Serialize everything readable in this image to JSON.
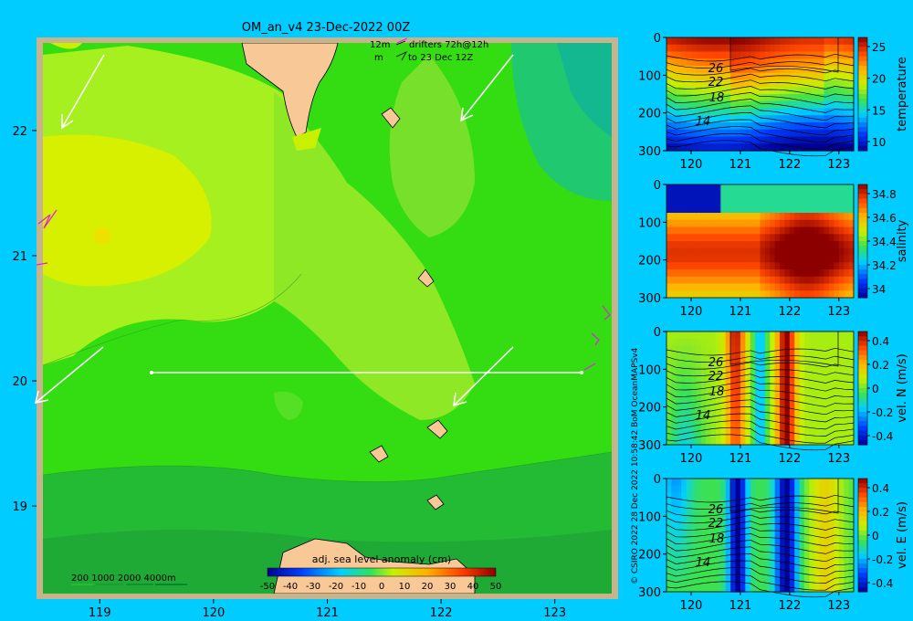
{
  "header": {
    "title": "OM_an_v4  23-Dec-2022 00Z",
    "legend_line1_left": "12m",
    "legend_line1_right": "drifters 72h@12h",
    "legend_line2_left": "m",
    "legend_line2_right": "to 23 Dec 12Z"
  },
  "map": {
    "x_ticks": [
      "119",
      "120",
      "121",
      "122",
      "123"
    ],
    "y_ticks": [
      "22",
      "21",
      "20",
      "19"
    ],
    "bathymetry_legend": "200  1000  2000  4000m",
    "colorbar_title": "adj. sea level anomaly (cm)",
    "colorbar_ticks": [
      "-50",
      "-40",
      "-30",
      "-20",
      "-10",
      "0",
      "10",
      "20",
      "30",
      "40",
      "50"
    ],
    "section_lat": 20,
    "section_lon_range": [
      119.5,
      123.3
    ]
  },
  "credit": "© CSIRO 2022   28 Dec 2022 10:58:42 BoM OceanMAPSv4",
  "panels": [
    {
      "ylabel": "temperature",
      "y_ticks": [
        "0",
        "100",
        "200",
        "300"
      ],
      "x_ticks": [
        "120",
        "121",
        "122",
        "123"
      ],
      "cbar_ticks": [
        "25",
        "20",
        "15",
        "10"
      ],
      "contour_labels": [
        "26",
        "22",
        "18",
        "14"
      ]
    },
    {
      "ylabel": "salinity",
      "y_ticks": [
        "0",
        "100",
        "200",
        "300"
      ],
      "x_ticks": [
        "120",
        "121",
        "122",
        "123"
      ],
      "cbar_ticks": [
        "34.8",
        "34.6",
        "34.4",
        "34.2",
        "34"
      ],
      "contour_labels": []
    },
    {
      "ylabel": "vel. N (m/s)",
      "y_ticks": [
        "0",
        "100",
        "200",
        "300"
      ],
      "x_ticks": [
        "120",
        "121",
        "122",
        "123"
      ],
      "cbar_ticks": [
        "0.4",
        "0.2",
        "0",
        "-0.2",
        "-0.4"
      ],
      "contour_labels": [
        "26",
        "22",
        "18",
        "14"
      ]
    },
    {
      "ylabel": "vel. E (m/s)",
      "y_ticks": [
        "0",
        "100",
        "200",
        "300"
      ],
      "x_ticks": [
        "120",
        "121",
        "122",
        "123"
      ],
      "cbar_ticks": [
        "0.4",
        "0.2",
        "0",
        "-0.2",
        "-0.4"
      ],
      "contour_labels": [
        "26",
        "22",
        "18",
        "14"
      ]
    }
  ],
  "chart_data": [
    {
      "type": "heatmap",
      "title": "OM_an_v4  23-Dec-2022 00Z",
      "xlabel": "",
      "ylabel": "",
      "xlim": [
        118.5,
        123.5
      ],
      "ylim": [
        18.3,
        22.7
      ],
      "colorbar_label": "adj. sea level anomaly (cm)",
      "clim": [
        -50,
        50
      ],
      "section": {
        "lat": 20,
        "lon_from": 119.5,
        "lon_to": 123.3
      }
    },
    {
      "type": "heatmap",
      "ylabel": "temperature",
      "xlim": [
        119.5,
        123.3
      ],
      "ylim": [
        300,
        0
      ],
      "clim": [
        8,
        29
      ],
      "contours": [
        26,
        22,
        18,
        14
      ]
    },
    {
      "type": "heatmap",
      "ylabel": "salinity",
      "xlim": [
        119.5,
        123.3
      ],
      "ylim": [
        300,
        0
      ],
      "clim": [
        33.85,
        34.9
      ]
    },
    {
      "type": "heatmap",
      "ylabel": "vel. N (m/s)",
      "xlim": [
        119.5,
        123.3
      ],
      "ylim": [
        300,
        0
      ],
      "clim": [
        -0.45,
        0.45
      ],
      "contours": [
        26,
        22,
        18,
        14
      ]
    },
    {
      "type": "heatmap",
      "ylabel": "vel. E (m/s)",
      "xlim": [
        119.5,
        123.3
      ],
      "ylim": [
        300,
        0
      ],
      "clim": [
        -0.45,
        0.45
      ],
      "contours": [
        26,
        22,
        18,
        14
      ]
    }
  ]
}
